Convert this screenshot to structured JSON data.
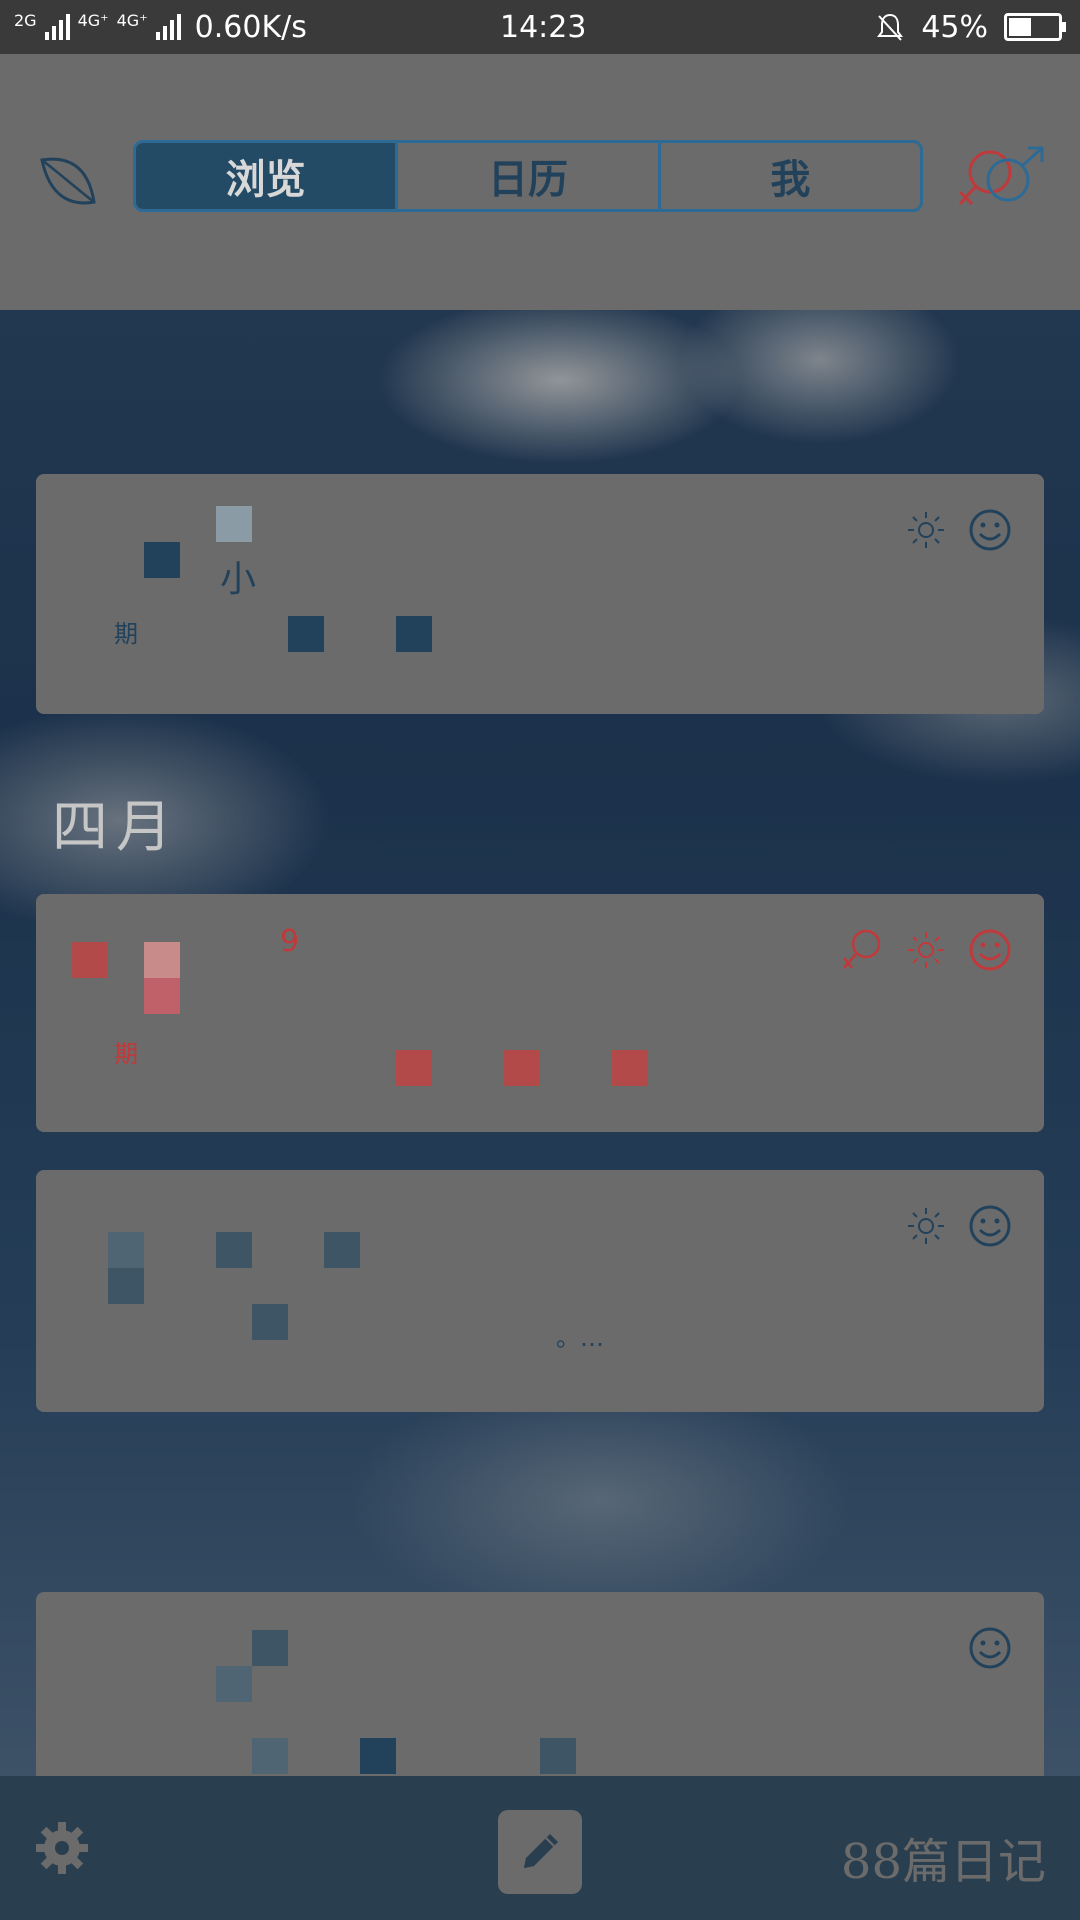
{
  "status_bar": {
    "net_label_1": "2G",
    "net_label_2": "4G⁺",
    "net_label_3": "4G⁺",
    "speed": "0.60K/s",
    "time": "14:23",
    "battery": "45%",
    "battery_level": 0.45
  },
  "header": {
    "tabs": [
      {
        "label": "浏览",
        "active": true
      },
      {
        "label": "日历",
        "active": false
      },
      {
        "label": "我",
        "active": false
      }
    ]
  },
  "entries": [
    {
      "title": "小",
      "line": "期",
      "icons": [
        "sun-icon",
        "smile-icon"
      ],
      "color": "#22425c"
    },
    {
      "month_heading": "四月"
    },
    {
      "title": "9",
      "line": "期",
      "icons": [
        "female-icon",
        "sun-icon",
        "smile-icon"
      ],
      "color": "#c0393b"
    },
    {
      "title": "",
      "line": "。…",
      "icons": [
        "sun-icon",
        "smile-icon"
      ],
      "color": "#22425c"
    },
    {
      "title": "",
      "line": "",
      "icons": [
        "smile-icon"
      ],
      "color": "#22425c"
    }
  ],
  "bottom_bar": {
    "diary_count": "88篇日记"
  },
  "colors": {
    "accent": "#2d6a96",
    "header_bg": "#6b6b6b",
    "bottom_bg": "#293e4f",
    "female_red": "#c0393b"
  }
}
